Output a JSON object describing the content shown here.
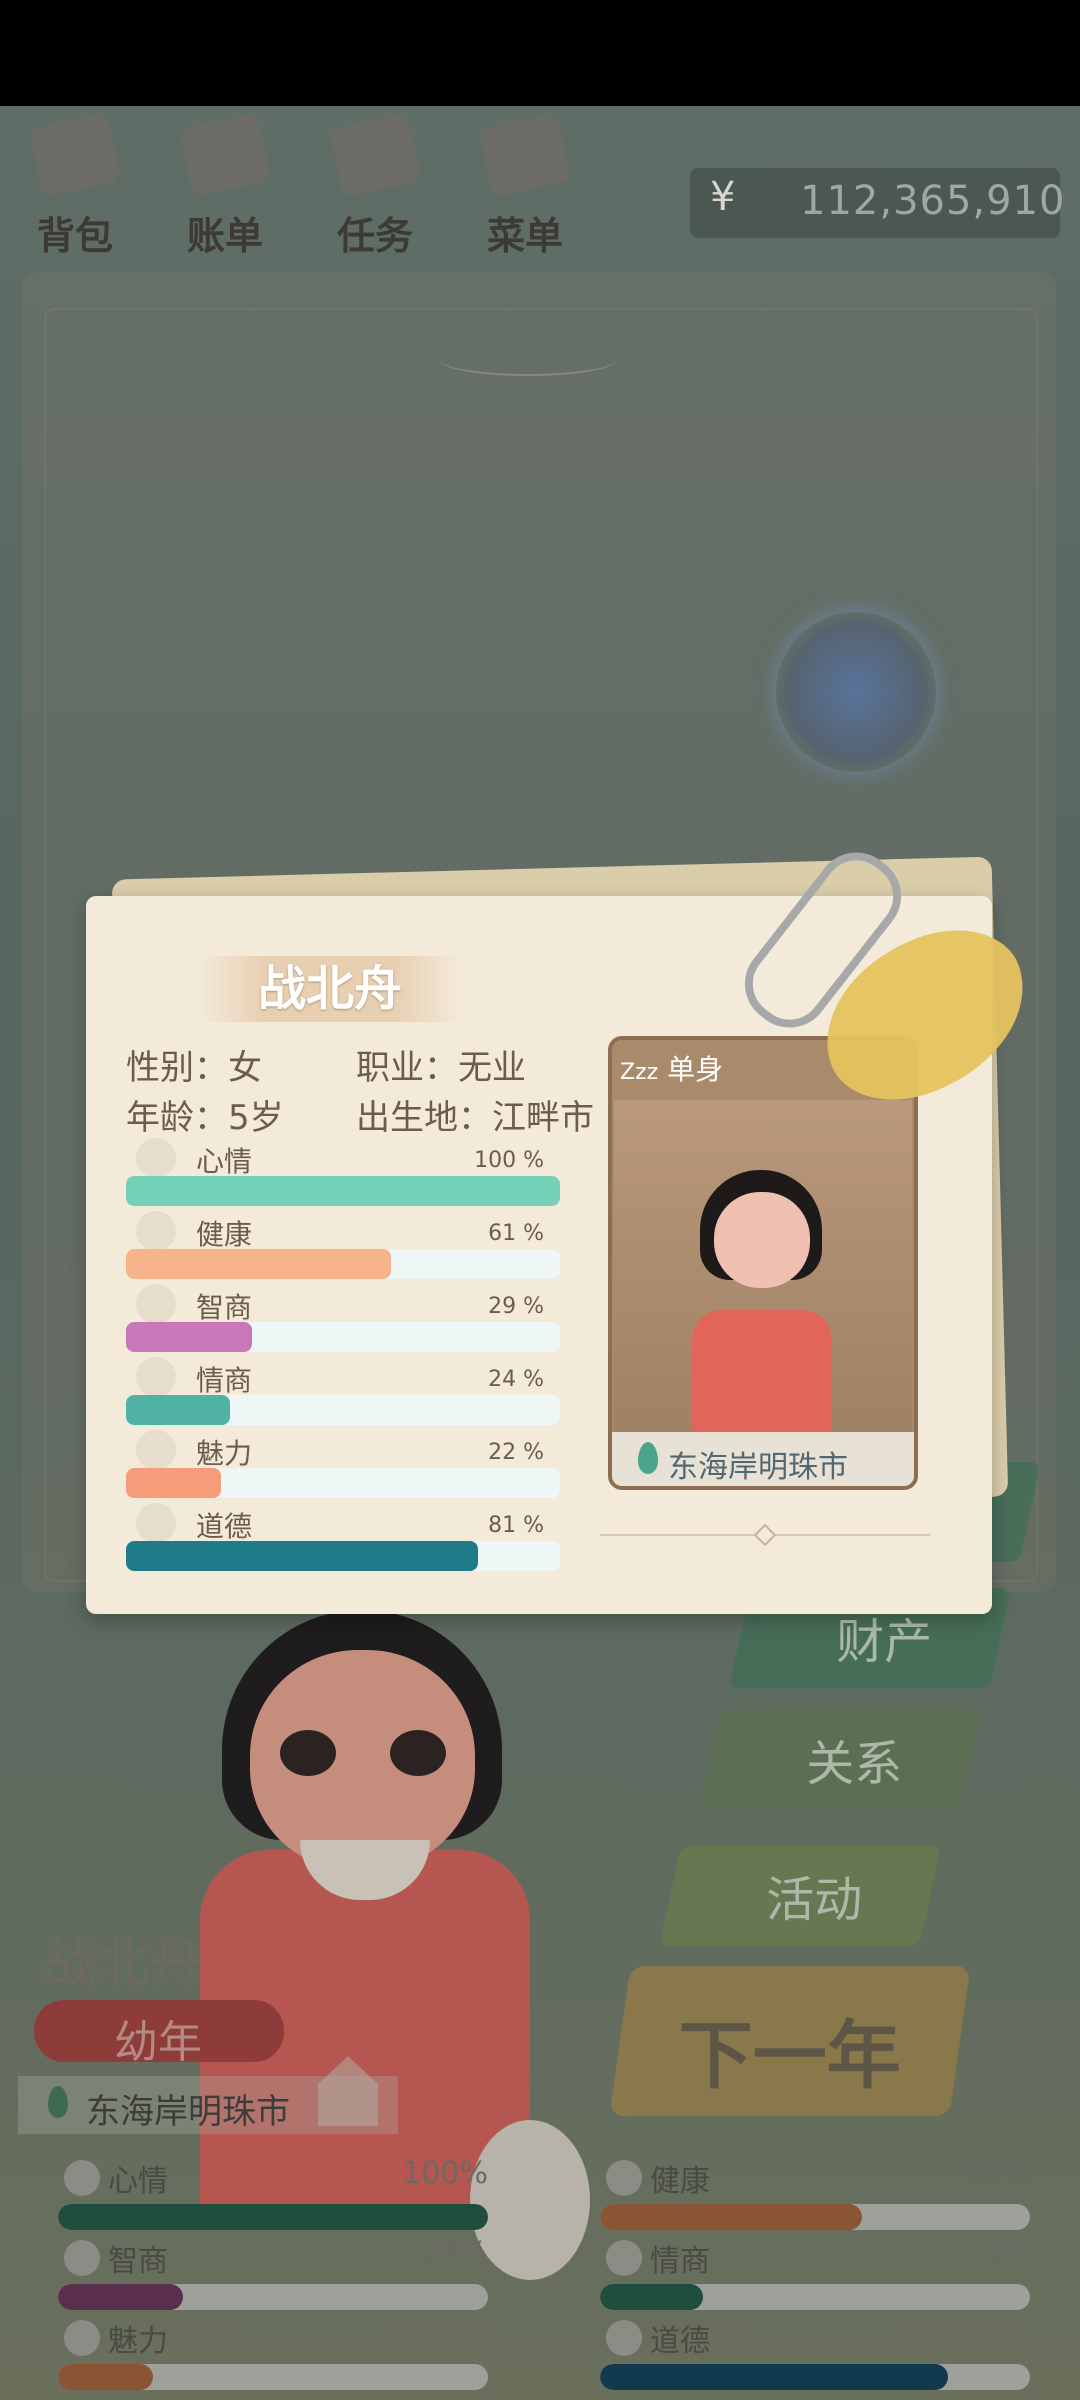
{
  "menu": [
    {
      "label": "背包",
      "icon": "backpack-icon"
    },
    {
      "label": "账单",
      "icon": "bill-icon"
    },
    {
      "label": "任务",
      "icon": "task-icon"
    },
    {
      "label": "菜单",
      "icon": "menu-book-icon"
    }
  ],
  "money": {
    "currency": "¥",
    "value": "112,365,910"
  },
  "side_buttons": {
    "property": "财产",
    "relations": "关系",
    "activity": "活动",
    "next_year": "下一年"
  },
  "character": {
    "name": "战北舟",
    "stage": "幼年",
    "location": "东海岸明珠市"
  },
  "bottom_stats": [
    {
      "label": "心情",
      "percent": "100%",
      "value": 1.0,
      "color": "#1f4d40"
    },
    {
      "label": "健康",
      "percent": "61%",
      "value": 0.61,
      "color": "#8a5534"
    },
    {
      "label": "智商",
      "percent": "29%",
      "value": 0.29,
      "color": "#5a2f4e"
    },
    {
      "label": "情商",
      "percent": "24%",
      "value": 0.24,
      "color": "#1f4d40"
    },
    {
      "label": "魅力",
      "percent": "22%",
      "value": 0.22,
      "color": "#8a5534"
    },
    {
      "label": "道德",
      "percent": "81%",
      "value": 0.81,
      "color": "#123a4e"
    }
  ],
  "card": {
    "name": "战北舟",
    "gender": "性别：女",
    "job": "职业：无业",
    "age": "年龄：5岁",
    "birthplace": "出生地：江畔市",
    "relationship": "单身",
    "location": "东海岸明珠市",
    "stats": [
      {
        "label": "心情",
        "percent": "100 %",
        "value": 1.0,
        "color": "#74d0b6",
        "icon": "smile-icon"
      },
      {
        "label": "健康",
        "percent": "61 %",
        "value": 0.61,
        "color": "#f7b48a",
        "icon": "heart-icon"
      },
      {
        "label": "智商",
        "percent": "29 %",
        "value": 0.29,
        "color": "#c878b8",
        "icon": "lightbulb-icon"
      },
      {
        "label": "情商",
        "percent": "24 %",
        "value": 0.24,
        "color": "#4fb2a4",
        "icon": "apple-icon"
      },
      {
        "label": "魅力",
        "percent": "22 %",
        "value": 0.22,
        "color": "#f59c7a",
        "icon": "sparkle-icon"
      },
      {
        "label": "道德",
        "percent": "81 %",
        "value": 0.81,
        "color": "#1f7a8a",
        "icon": "scales-icon"
      }
    ]
  }
}
